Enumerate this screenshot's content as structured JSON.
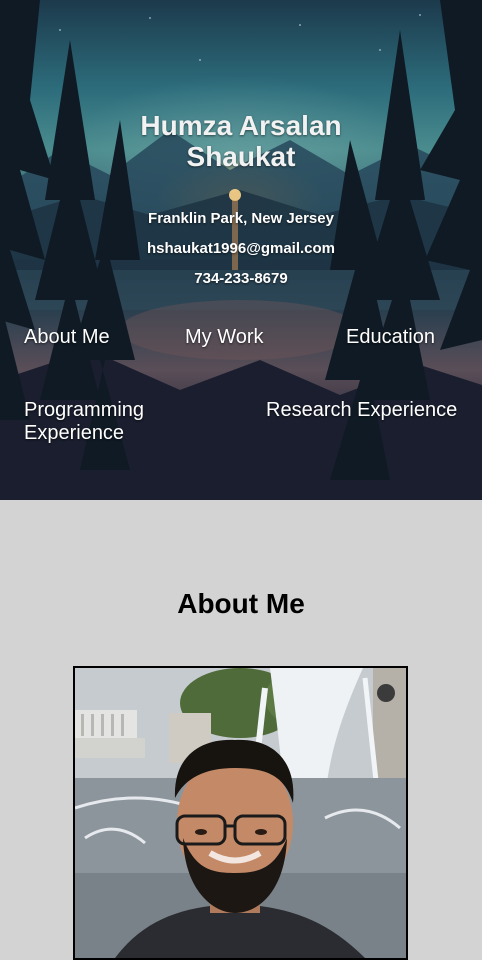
{
  "header": {
    "name_line1": "Humza Arsalan",
    "name_line2": "Shaukat",
    "location": "Franklin Park, New Jersey",
    "email": "hshaukat1996@gmail.com",
    "phone": "734-233-8679"
  },
  "nav": {
    "items": [
      {
        "label": "About Me"
      },
      {
        "label": "My Work"
      },
      {
        "label": "Education"
      },
      {
        "label_line1": "Programming",
        "label_line2": "Experience"
      },
      {
        "label": "Research Experience"
      }
    ]
  },
  "about": {
    "title": "About Me",
    "photo_alt": "Portrait photo"
  },
  "colors": {
    "page_bg": "#d3d3d3",
    "hero_dark": "#171a2a",
    "hero_teal": "#2d6d7c",
    "text_light": "#ffffff"
  }
}
